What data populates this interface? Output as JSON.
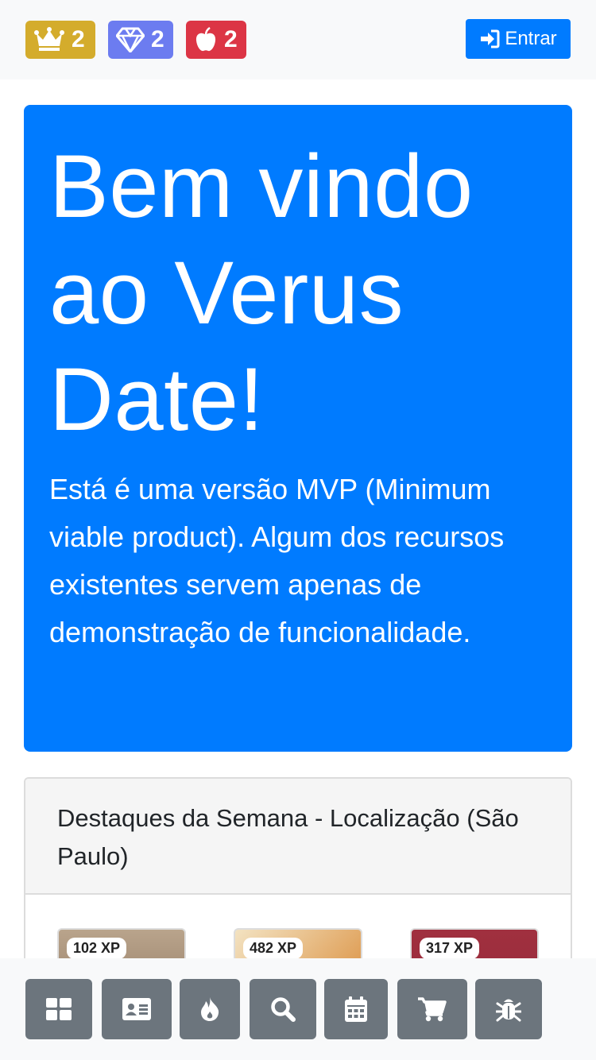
{
  "header": {
    "badges": [
      {
        "icon": "crown-icon",
        "count": "2",
        "color": "#d4ac2c"
      },
      {
        "icon": "diamond-icon",
        "count": "2",
        "color": "#6c7cf0"
      },
      {
        "icon": "apple-icon",
        "count": "2",
        "color": "#dc3545"
      }
    ],
    "login_label": "Entrar"
  },
  "hero": {
    "title": "Bem vindo ao Verus Date!",
    "text": "Está é uma versão MVP (Minimum viable product). Algum dos recursos existentes servem apenas de demonstração de funcionalidade."
  },
  "highlights": {
    "title": "Destaques da Semana - Localização (São Paulo)",
    "profiles": [
      {
        "xp": "102 XP"
      },
      {
        "xp": "482 XP"
      },
      {
        "xp": "317 XP"
      }
    ]
  },
  "bottom_nav": {
    "items": [
      {
        "icon": "dashboard-icon"
      },
      {
        "icon": "id-card-icon"
      },
      {
        "icon": "fire-icon"
      },
      {
        "icon": "search-icon"
      },
      {
        "icon": "calendar-icon"
      },
      {
        "icon": "cart-icon"
      },
      {
        "icon": "bug-icon"
      }
    ]
  },
  "colors": {
    "primary": "#007bff",
    "secondary": "#6c757d"
  }
}
